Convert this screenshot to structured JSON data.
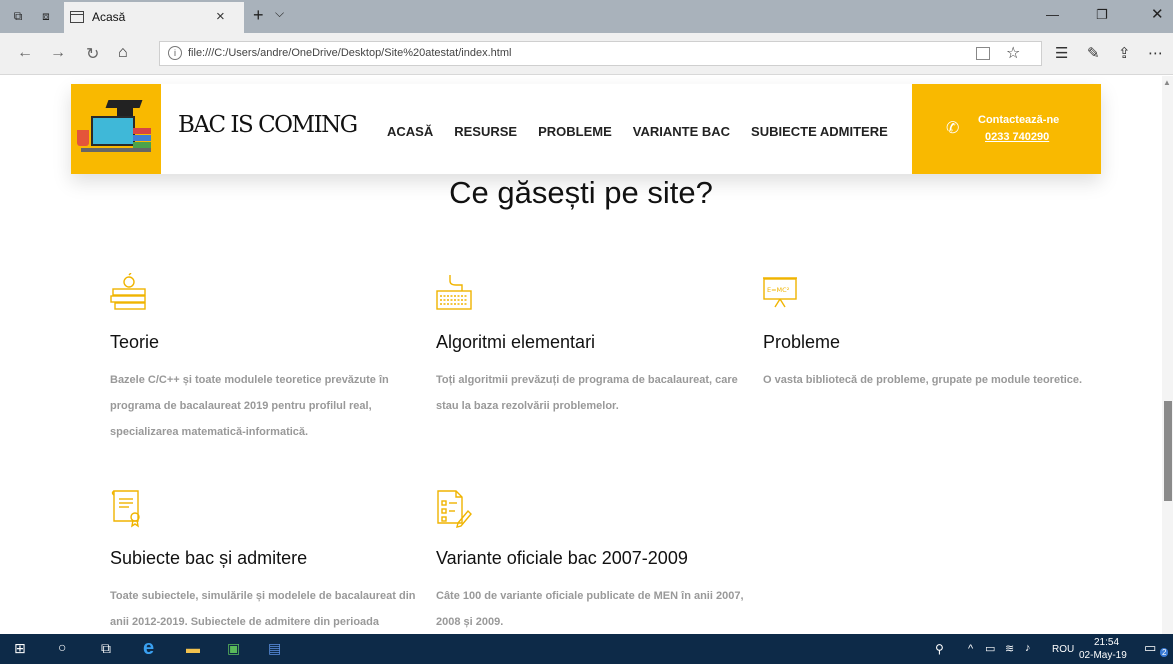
{
  "browser": {
    "tab_title": "Acasă",
    "url": "file:///C:/Users/andre/OneDrive/Desktop/Site%20atestat/index.html"
  },
  "site": {
    "brand": "BAC IS COMING",
    "nav": [
      "ACASĂ",
      "RESURSE",
      "PROBLEME",
      "VARIANTE BAC",
      "SUBIECTE ADMITERE"
    ],
    "contact_label": "Contactează-ne",
    "contact_phone": "0233 740290",
    "section_title": "Ce găsești pe site?",
    "features": [
      {
        "icon": "books-apple-icon",
        "title": "Teorie",
        "desc": "Bazele C/C++ și toate modulele teoretice prevăzute în programa de bacalaureat 2019 pentru profilul real, specializarea matematică-informatică."
      },
      {
        "icon": "keyboard-icon",
        "title": "Algoritmi elementari",
        "desc": "Toți algoritmii prevăzuți de programa de bacalaureat, care stau la baza rezolvării problemelor."
      },
      {
        "icon": "presentation-board-icon",
        "title": "Probleme",
        "desc": "O vasta bibliotecă de probleme, grupate pe module teoretice."
      },
      {
        "icon": "certificate-icon",
        "title": "Subiecte bac și admitere",
        "desc": "Toate subiectele, simulările și modelele de bacalaureat din anii 2012-2019. Subiectele de admitere din perioada"
      },
      {
        "icon": "checklist-icon",
        "title": "Variante oficiale bac 2007-2009",
        "desc": "Câte 100 de variante oficiale publicate de MEN în anii 2007, 2008 și 2009."
      }
    ]
  },
  "taskbar": {
    "lang": "ROU",
    "time": "21:54",
    "date": "02-May-19",
    "notif": "2"
  },
  "colors": {
    "accent": "#f9b900",
    "taskbar": "#0d2a48"
  }
}
